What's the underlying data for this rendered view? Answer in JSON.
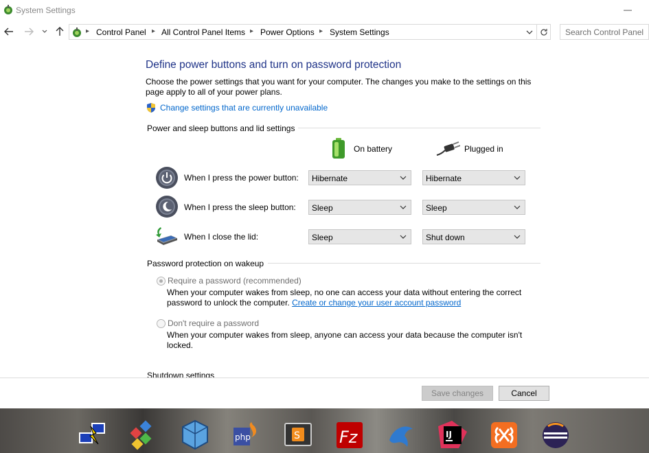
{
  "window": {
    "title": "System Settings",
    "minimize": "—"
  },
  "breadcrumbs": [
    "Control Panel",
    "All Control Panel Items",
    "Power Options",
    "System Settings"
  ],
  "search": {
    "placeholder": "Search Control Panel"
  },
  "page": {
    "heading": "Define power buttons and turn on password protection",
    "description": "Choose the power settings that you want for your computer. The changes you make to the settings on this page apply to all of your power plans.",
    "change_link": "Change settings that are currently unavailable"
  },
  "power": {
    "group_title": "Power and sleep buttons and lid settings",
    "col_battery": "On battery",
    "col_plugged": "Plugged in",
    "rows": [
      {
        "label": "When I press the power button:",
        "battery": "Hibernate",
        "plugged": "Hibernate"
      },
      {
        "label": "When I press the sleep button:",
        "battery": "Sleep",
        "plugged": "Sleep"
      },
      {
        "label": "When I close the lid:",
        "battery": "Sleep",
        "plugged": "Shut down"
      }
    ]
  },
  "password": {
    "group_title": "Password protection on wakeup",
    "require_label": "Require a password (recommended)",
    "require_desc": "When your computer wakes from sleep, no one can access your data without entering the correct password to unlock the computer.",
    "require_link": "Create or change your user account password",
    "norequire_label": "Don't require a password",
    "norequire_desc": "When your computer wakes from sleep, anyone can access your data because the computer isn't locked.",
    "selected": "require"
  },
  "shutdown": {
    "group_title": "Shutdown settings"
  },
  "footer": {
    "save": "Save changes",
    "cancel": "Cancel"
  },
  "taskbar": {
    "apps": [
      "network-app",
      "control-panel-app",
      "virtualbox-app",
      "phpstorm-app",
      "sublime-text-app",
      "filezilla-app",
      "mysql-workbench-app",
      "intellij-idea-app",
      "xampp-app",
      "eclipse-app"
    ]
  }
}
